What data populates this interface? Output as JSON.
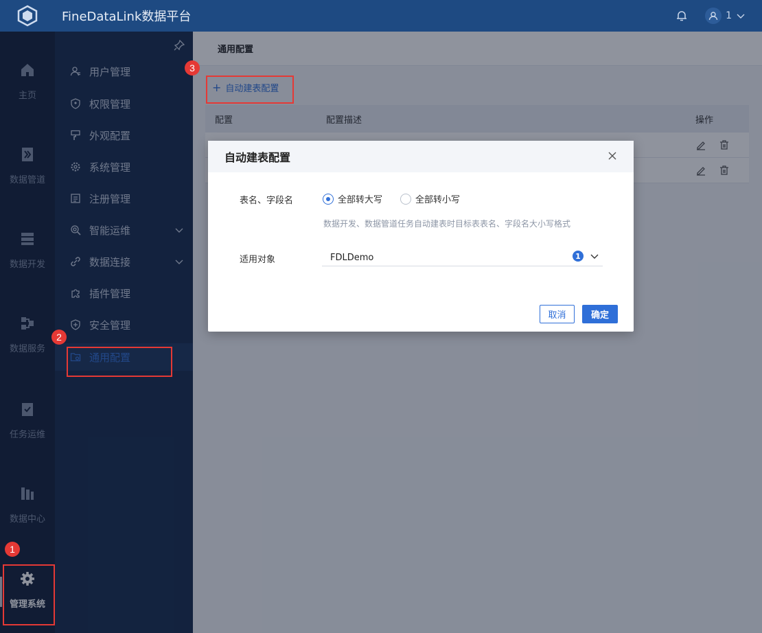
{
  "app": {
    "title": "FineDataLink数据平台"
  },
  "user": {
    "name": "1"
  },
  "rail": [
    {
      "label": "主页",
      "icon": "home-icon"
    },
    {
      "label": "数据管道",
      "icon": "pipeline-icon"
    },
    {
      "label": "数据开发",
      "icon": "dev-icon"
    },
    {
      "label": "数据服务",
      "icon": "service-icon"
    },
    {
      "label": "任务运维",
      "icon": "task-icon"
    },
    {
      "label": "数据中心",
      "icon": "datacenter-icon"
    },
    {
      "label": "管理系统",
      "icon": "gear-icon",
      "active": true
    }
  ],
  "submenu": [
    {
      "label": "用户管理",
      "icon": "user-icon"
    },
    {
      "label": "权限管理",
      "icon": "shield-icon"
    },
    {
      "label": "外观配置",
      "icon": "brush-icon"
    },
    {
      "label": "系统管理",
      "icon": "settings-icon"
    },
    {
      "label": "注册管理",
      "icon": "register-icon"
    },
    {
      "label": "智能运维",
      "icon": "monitor-icon",
      "expandable": true
    },
    {
      "label": "数据连接",
      "icon": "link-icon",
      "expandable": true
    },
    {
      "label": "插件管理",
      "icon": "puzzle-icon"
    },
    {
      "label": "安全管理",
      "icon": "security-icon"
    },
    {
      "label": "通用配置",
      "icon": "config-icon",
      "active": true
    }
  ],
  "main": {
    "header": "通用配置",
    "add_label": "自动建表配置",
    "table": {
      "columns": [
        "配置",
        "配置描述",
        "操作"
      ],
      "rows": 2
    }
  },
  "modal": {
    "title": "自动建表配置",
    "field1_label": "表名、字段名",
    "radio_upper": "全部转大写",
    "radio_lower": "全部转小写",
    "selected": "upper",
    "hint": "数据开发、数据管道任务自动建表时目标表表名、字段名大小写格式",
    "field2_label": "适用对象",
    "select_value": "FDLDemo",
    "select_count": "1",
    "cancel": "取消",
    "ok": "确定"
  },
  "annotations": [
    "1",
    "2",
    "3"
  ],
  "colors": {
    "accent": "#2f6fd8",
    "marker": "#e53935",
    "topbar": "#1e4a82"
  }
}
